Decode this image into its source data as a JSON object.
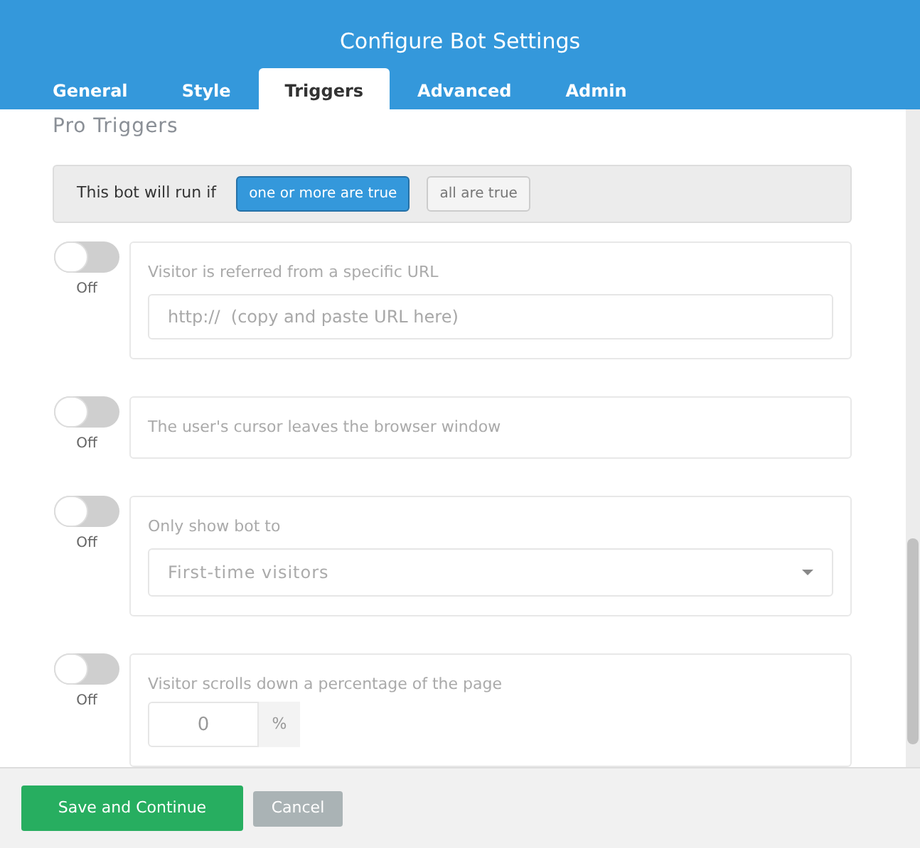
{
  "window": {
    "title": "Configure Bot Settings"
  },
  "tabs": [
    {
      "label": "General",
      "selected": false
    },
    {
      "label": "Style",
      "selected": false
    },
    {
      "label": "Triggers",
      "selected": true
    },
    {
      "label": "Advanced",
      "selected": false
    },
    {
      "label": "Admin",
      "selected": false
    }
  ],
  "section_title": "Pro Triggers",
  "run_condition": {
    "label": "This bot will run if",
    "options": [
      {
        "label": "one or more are true",
        "selected": true
      },
      {
        "label": "all are true",
        "selected": false
      }
    ]
  },
  "triggers": [
    {
      "kind": "url",
      "on": false,
      "state_label": "Off",
      "label": "Visitor is referred from a specific URL",
      "placeholder": "http://  (copy and paste URL here)"
    },
    {
      "kind": "plain",
      "on": false,
      "state_label": "Off",
      "label": "The user's cursor leaves the browser window"
    },
    {
      "kind": "select",
      "on": false,
      "state_label": "Off",
      "label": "Only show bot to",
      "value": "First-time visitors"
    },
    {
      "kind": "percent",
      "on": false,
      "state_label": "Off",
      "label": "Visitor scrolls down a percentage of the page",
      "value": "0",
      "unit": "%"
    }
  ],
  "footer": {
    "save": "Save and Continue",
    "cancel": "Cancel"
  }
}
